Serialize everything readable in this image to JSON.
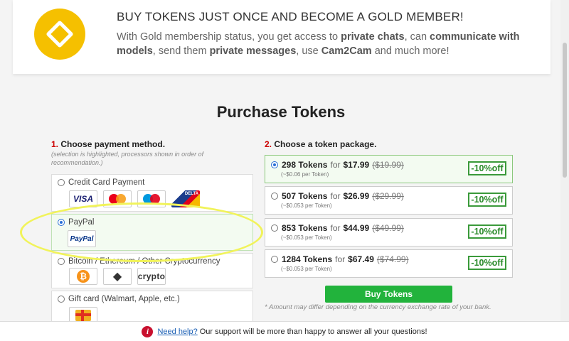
{
  "banner": {
    "title": "BUY TOKENS JUST ONCE AND BECOME A GOLD MEMBER!",
    "text_parts": [
      "With Gold membership status, you get access to ",
      "private chats",
      ", can ",
      "communicate with models",
      ", send them ",
      "private messages",
      ", use ",
      "Cam2Cam",
      " and much more!"
    ]
  },
  "purchase": {
    "title": "Purchase Tokens"
  },
  "step1": {
    "num": "1.",
    "title": "Choose payment method.",
    "note": "(selection is highlighted, processors shown in order of recommendation.)",
    "methods": [
      {
        "label": "Credit Card Payment",
        "logos": [
          "VISA",
          "mastercard",
          "Maestro",
          "DELTA"
        ]
      },
      {
        "label": "PayPal",
        "logos": [
          "PayPal"
        ]
      },
      {
        "label": "Bitcoin / Ethereum / Other Cryptocurrency",
        "logos": [
          "₿",
          "ethereum",
          "crypto"
        ]
      },
      {
        "label": "Gift card (Walmart, Apple, etc.)"
      }
    ]
  },
  "step2": {
    "num": "2.",
    "title": "Choose a token package.",
    "packages": [
      {
        "tokens": "298 Tokens",
        "for": "for",
        "price": "$17.99",
        "old": "($19.99)",
        "per": "(~$0.06 per Token)",
        "discount": "-10%off"
      },
      {
        "tokens": "507 Tokens",
        "for": "for",
        "price": "$26.99",
        "old": "($29.99)",
        "per": "(~$0.053 per Token)",
        "discount": "-10%off"
      },
      {
        "tokens": "853 Tokens",
        "for": "for",
        "price": "$44.99",
        "old": "($49.99)",
        "per": "(~$0.053 per Token)",
        "discount": "-10%off"
      },
      {
        "tokens": "1284 Tokens",
        "for": "for",
        "price": "$67.49",
        "old": "($74.99)",
        "per": "(~$0.053 per Token)",
        "discount": "-10%off"
      }
    ],
    "buy_label": "Buy Tokens",
    "footnote": "* Amount may differ depending on the currency exchange rate of your bank."
  },
  "help": {
    "icon": "i",
    "link": "Need help?",
    "text": "Our support will be more than happy to answer all your questions!"
  },
  "colors": {
    "gold": "#f5c000",
    "buy_button": "#22b33c",
    "discount": "#3a9a3a",
    "highlight_ellipse": "#f1f35a"
  },
  "icons": {
    "logo": "gold-diamond-icon",
    "help": "info-icon"
  }
}
